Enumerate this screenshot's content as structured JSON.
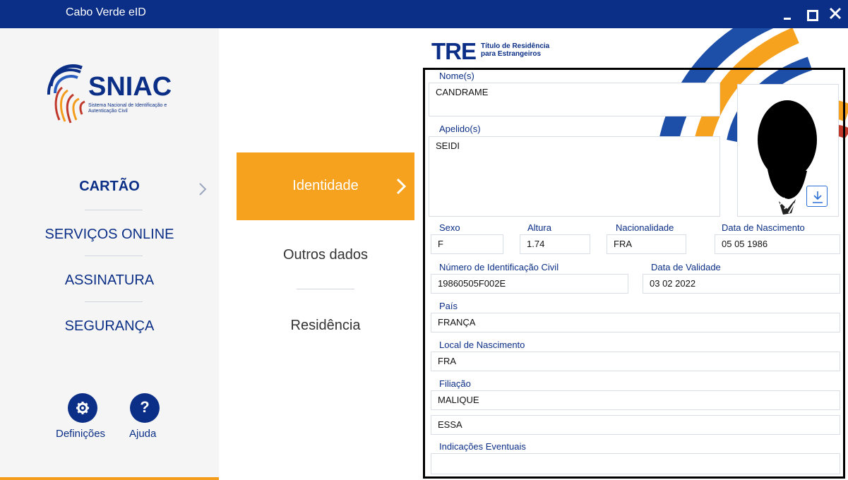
{
  "window": {
    "title": "Cabo Verde eID"
  },
  "logo": {
    "name": "SNIAC",
    "subtitle": "Sistema Nacional de Identificação e Autenticação Civil"
  },
  "nav": {
    "items": [
      {
        "label": "CARTÃO",
        "active": true
      },
      {
        "label": "SERVIÇOS ONLINE",
        "active": false
      },
      {
        "label": "ASSINATURA",
        "active": false
      },
      {
        "label": "SEGURANÇA",
        "active": false
      }
    ],
    "settings_label": "Definições",
    "help_label": "Ajuda"
  },
  "tabs": [
    {
      "label": "Identidade",
      "active": true
    },
    {
      "label": "Outros dados",
      "active": false
    },
    {
      "label": "Residência",
      "active": false
    }
  ],
  "card": {
    "brand": "TRE",
    "brand_line1": "Título de Residência",
    "brand_line2": "para Estrangeiros",
    "fields": {
      "nomes_label": "Nome(s)",
      "nomes_value": "CANDRAME",
      "apelidos_label": "Apelido(s)",
      "apelidos_value": "SEIDI",
      "sexo_label": "Sexo",
      "sexo_value": "F",
      "altura_label": "Altura",
      "altura_value": "1.74",
      "nacionalidade_label": "Nacionalidade",
      "nacionalidade_value": "FRA",
      "nascimento_label": "Data de Nascimento",
      "nascimento_value": "05 05 1986",
      "nic_label": "Número de Identificação Civil",
      "nic_value": "19860505F002E",
      "validade_label": "Data de Validade",
      "validade_value": "03 02 2022",
      "pais_label": "País",
      "pais_value": "FRANÇA",
      "local_label": "Local de Nascimento",
      "local_value": "FRA",
      "filiacao_label": "Filiação",
      "filiacao_value_1": "MALIQUE",
      "filiacao_value_2": "ESSA",
      "indicacoes_label": "Indicações Eventuais",
      "indicacoes_value": ""
    }
  },
  "colors": {
    "navy": "#0b2f86",
    "orange": "#f6a21e"
  }
}
